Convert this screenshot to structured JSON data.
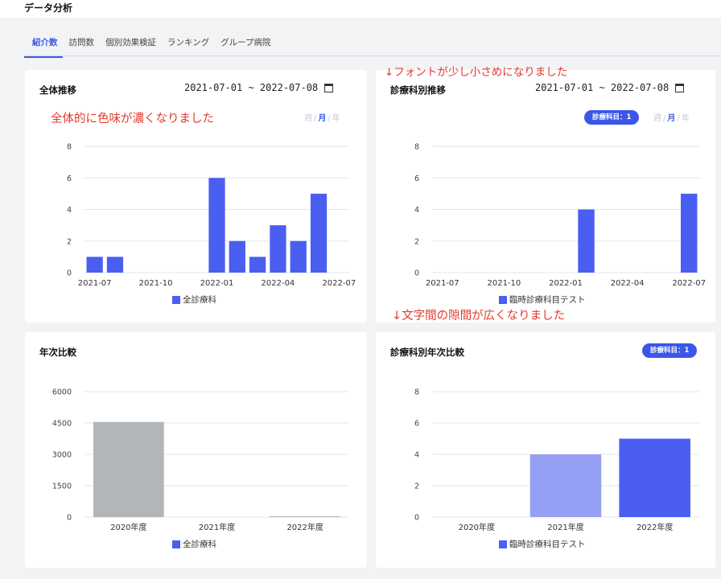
{
  "page_title": "データ分析",
  "tabs": [
    {
      "label": "紹介数",
      "active": true
    },
    {
      "label": "訪問数",
      "active": false
    },
    {
      "label": "個別効果検証",
      "active": false
    },
    {
      "label": "ランキング",
      "active": false
    },
    {
      "label": "グループ病院",
      "active": false
    }
  ],
  "annotations": {
    "font_smaller": "↓フォントが少し小さめになりました",
    "color_darker": "全体的に色味が濃くなりました",
    "spacing_wider": "↓文字間の隙間が広くなりました"
  },
  "colors": {
    "accent": "#3a57e8",
    "bar": "#4a5ef2",
    "bar_light": "#95a0f5",
    "bar_gray": "#b3b6b9",
    "annotation": "#e33a2d"
  },
  "cards": {
    "overall_trend": {
      "title": "全体推移",
      "date_range": "2021-07-01 ~ 2022-07-08",
      "period": {
        "week": "週",
        "month": "月",
        "year": "年",
        "selected": "month"
      },
      "legend": "全診療科"
    },
    "dept_trend": {
      "title": "診療科別推移",
      "date_range": "2021-07-01 ~ 2022-07-08",
      "badge": "診療科目：1",
      "period": {
        "week": "週",
        "month": "月",
        "year": "年",
        "selected": "month"
      },
      "legend": "臨時診療科目テスト"
    },
    "annual_compare": {
      "title": "年次比較",
      "legend": "全診療科"
    },
    "dept_annual_compare": {
      "title": "診療科別年次比較",
      "badge": "診療科目：1",
      "legend": "臨時診療科目テスト"
    }
  },
  "chart_data": [
    {
      "type": "bar",
      "id": "overall_trend",
      "x": [
        "2021-07",
        "2021-08",
        "2021-09",
        "2021-10",
        "2021-11",
        "2021-12",
        "2022-01",
        "2022-02",
        "2022-03",
        "2022-04",
        "2022-05",
        "2022-06",
        "2022-07"
      ],
      "xticks": [
        "2021-07",
        "2021-10",
        "2022-01",
        "2022-04",
        "2022-07"
      ],
      "series": [
        {
          "name": "全診療科",
          "values": [
            1,
            1,
            0,
            0,
            0,
            0,
            6,
            2,
            1,
            3,
            2,
            5,
            0
          ]
        }
      ],
      "yticks": [
        0,
        2,
        4,
        6,
        8
      ],
      "ylim": [
        0,
        8
      ]
    },
    {
      "type": "bar",
      "id": "dept_trend",
      "x": [
        "2021-07",
        "2021-08",
        "2021-09",
        "2021-10",
        "2021-11",
        "2021-12",
        "2022-01",
        "2022-02",
        "2022-03",
        "2022-04",
        "2022-05",
        "2022-06",
        "2022-07"
      ],
      "xticks": [
        "2021-07",
        "2021-10",
        "2022-01",
        "2022-04",
        "2022-07"
      ],
      "series": [
        {
          "name": "臨時診療科目テスト",
          "values": [
            0,
            0,
            0,
            0,
            0,
            0,
            0,
            4,
            0,
            0,
            0,
            0,
            5
          ]
        }
      ],
      "yticks": [
        0,
        2,
        4,
        6,
        8
      ],
      "ylim": [
        0,
        8
      ]
    },
    {
      "type": "bar",
      "id": "annual_compare",
      "categories": [
        "2020年度",
        "2021年度",
        "2022年度"
      ],
      "series": [
        {
          "name": "全診療科",
          "values": [
            4550,
            0,
            10
          ]
        }
      ],
      "yticks": [
        0,
        1500,
        3000,
        4500,
        6000
      ],
      "ylim": [
        0,
        6000
      ]
    },
    {
      "type": "bar",
      "id": "dept_annual_compare",
      "categories": [
        "2020年度",
        "2021年度",
        "2022年度"
      ],
      "series": [
        {
          "name": "臨時診療科目テスト",
          "values": [
            0,
            4,
            5
          ]
        }
      ],
      "yticks": [
        0,
        2,
        4,
        6,
        8
      ],
      "ylim": [
        0,
        8
      ]
    }
  ]
}
